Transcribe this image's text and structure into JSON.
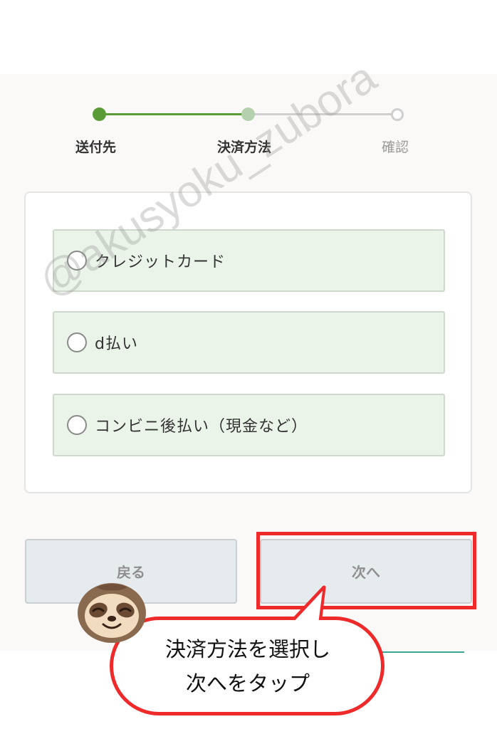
{
  "stepper": {
    "steps": [
      {
        "label": "送付先",
        "state": "done"
      },
      {
        "label": "決済方法",
        "state": "current"
      },
      {
        "label": "確認",
        "state": "todo"
      }
    ]
  },
  "payment_options": [
    {
      "label": "クレジットカード"
    },
    {
      "label": "d払い"
    },
    {
      "label": "コンビニ後払い（現金など）"
    }
  ],
  "buttons": {
    "back_label": "戻る",
    "next_label": "次へ"
  },
  "annotation": {
    "watermark": "@akusyoku_zubora",
    "bubble_line1": "決済方法を選択し",
    "bubble_line2": "次へをタップ"
  },
  "colors": {
    "accent_green": "#5a9a37",
    "option_bg": "#eaf4e8",
    "highlight_red": "#ee2a2a"
  }
}
